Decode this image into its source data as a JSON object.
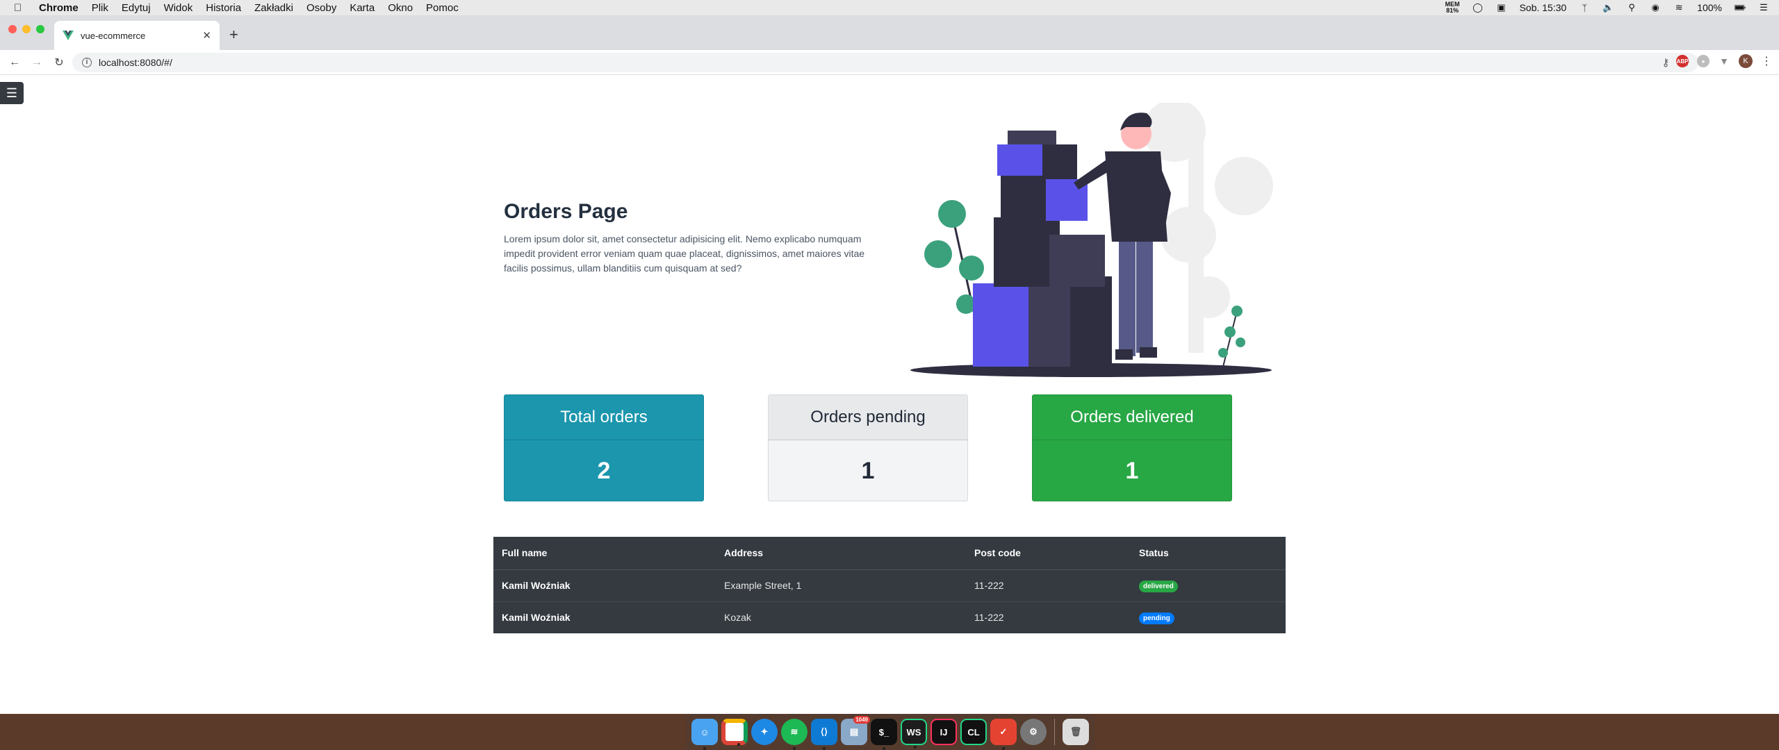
{
  "menubar": {
    "app_name": "Chrome",
    "menus": [
      "Plik",
      "Edytuj",
      "Widok",
      "Historia",
      "Zakładki",
      "Osoby",
      "Karta",
      "Okno",
      "Pomoc"
    ],
    "mem_label": "MEM",
    "mem_value": "81%",
    "clock": "Sob. 15:30",
    "battery": "100%"
  },
  "browser": {
    "tab_title": "vue-ecommerce",
    "url": "localhost:8080/#/",
    "avatar_initial": "K"
  },
  "hero": {
    "title": "Orders Page",
    "description": "Lorem ipsum dolor sit, amet consectetur adipisicing elit. Nemo explicabo numquam impedit provident error veniam quam quae placeat, dignissimos, amet maiores vitae facilis possimus, ullam blanditiis cum quisquam at sed?"
  },
  "cards": {
    "total": {
      "label": "Total orders",
      "value": "2",
      "color": "#1b96ad"
    },
    "pending": {
      "label": "Orders pending",
      "value": "1",
      "color": "#f3f4f6"
    },
    "delivered": {
      "label": "Orders delivered",
      "value": "1",
      "color": "#28a745"
    }
  },
  "orders_table": {
    "headers": [
      "Full name",
      "Address",
      "Post code",
      "Status"
    ],
    "rows": [
      {
        "name": "Kamil Woźniak",
        "address": "Example Street, 1",
        "postcode": "11-222",
        "status": "delivered"
      },
      {
        "name": "Kamil Woźniak",
        "address": "Kozak",
        "postcode": "11-222",
        "status": "pending"
      }
    ]
  },
  "dock": {
    "apps": [
      "finder",
      "chrome",
      "safari",
      "spotify",
      "vscode",
      "preview",
      "terminal",
      "webstorm",
      "intellij",
      "clion",
      "todoist",
      "system-preferences",
      "trash"
    ],
    "preview_badge": "1049"
  }
}
